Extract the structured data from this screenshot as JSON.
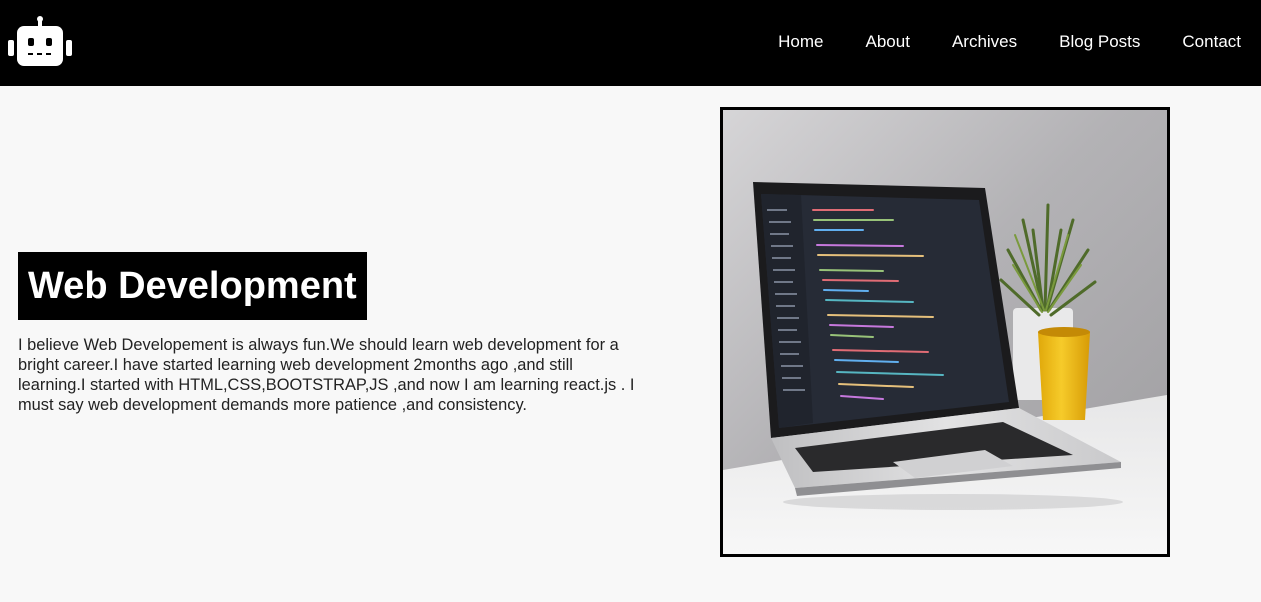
{
  "nav": {
    "logo_icon": "robot-icon",
    "links": [
      {
        "label": "Home"
      },
      {
        "label": "About"
      },
      {
        "label": "Archives"
      },
      {
        "label": "Blog Posts"
      },
      {
        "label": "Contact"
      }
    ]
  },
  "hero": {
    "title": "Web Development",
    "paragraph": "I believe Web Developement is always fun.We should learn web development for a bright career.I have started learning web development 2months ago ,and still learning.I started with HTML,CSS,BOOTSTRAP,JS ,and now I am learning react.js . I must say web development demands more patience ,and consistency."
  },
  "colors": {
    "navbar_bg": "#000000",
    "page_bg": "#f8f8f8",
    "title_bg": "#000000",
    "title_text": "#ffffff",
    "cup": "#f2c318"
  }
}
